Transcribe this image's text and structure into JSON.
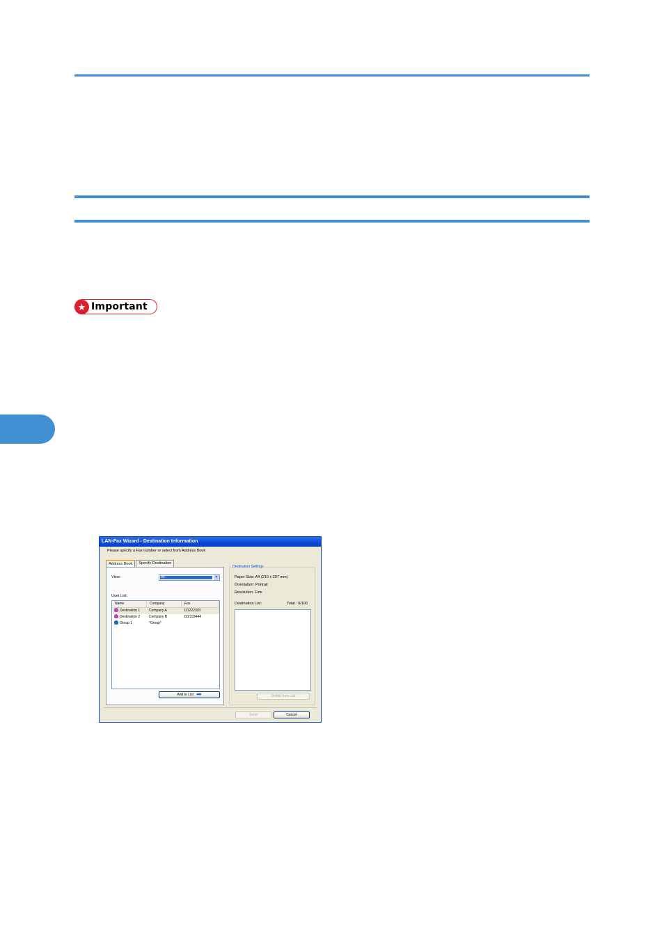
{
  "important": {
    "label": "Important"
  },
  "dialog": {
    "title": "LAN-Fax Wizard - Destination Information",
    "instruction": "Please specify a Fax number or select from Address Book",
    "tabs": [
      {
        "label": "Address Book",
        "active": true
      },
      {
        "label": "Specify Destination",
        "active": false
      }
    ],
    "view": {
      "label": "View:",
      "value": "All"
    },
    "user_list": {
      "label": "User List:",
      "columns": [
        "Name",
        "Company",
        "Fax"
      ],
      "rows": [
        {
          "name": "Destination 1",
          "company": "Company A",
          "fax": "111222333",
          "icon": "user-icon",
          "icon_color": "#b04ab0"
        },
        {
          "name": "Destination 2",
          "company": "Company B",
          "fax": "222333444",
          "icon": "user-icon",
          "icon_color": "#b04ab0"
        },
        {
          "name": "Group 1",
          "company": "*Group*",
          "fax": "",
          "icon": "group-icon",
          "icon_color": "#2a64c8"
        }
      ]
    },
    "add_button": "Add to List",
    "destination_settings": {
      "caption": "Destination Settings",
      "paper_size": "Paper Size: A4 (210 x 297 mm)",
      "orientation": "Orientation: Portrait",
      "resolution": "Resolution: Fine",
      "list_label": "Destination List:",
      "total": "Total :   0/100"
    },
    "delete_button": "Delete from List",
    "send_button": "Send",
    "cancel_button": "Cancel"
  },
  "colors": {
    "accent": "#3f8fd2",
    "important_red": "#d8202f",
    "titlebar": "#0a4bd6"
  }
}
